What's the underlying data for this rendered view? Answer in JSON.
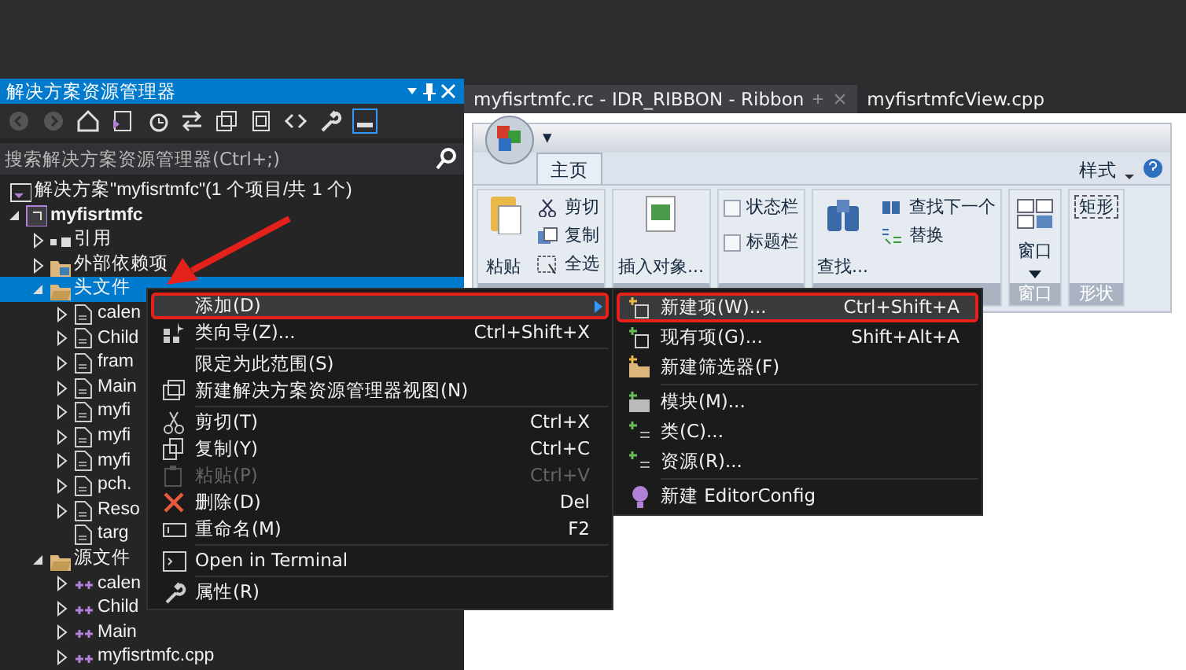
{
  "explorer": {
    "title": "解决方案资源管理器",
    "search": {
      "placeholder": "搜索解决方案资源管理器(Ctrl+;)"
    },
    "tree": [
      {
        "label": "解决方案\"myfisrtmfc\"(1 个项目/共 1 个)",
        "kind": "solution",
        "selected": false,
        "children": [
          {
            "label": "myfisrtmfc",
            "kind": "project",
            "expanded": true,
            "selected": false,
            "children": [
              {
                "label": "引用",
                "kind": "refs",
                "expanded": false,
                "selected": false
              },
              {
                "label": "外部依赖项",
                "kind": "deps",
                "expanded": false,
                "selected": false
              },
              {
                "label": "头文件",
                "kind": "folder",
                "expanded": true,
                "selected": true,
                "children": [
                  {
                    "label": "calen",
                    "kind": "header",
                    "expanded": false,
                    "selected": false
                  },
                  {
                    "label": "Child",
                    "kind": "header",
                    "expanded": false,
                    "selected": false
                  },
                  {
                    "label": "fram",
                    "kind": "header",
                    "expanded": false,
                    "selected": false
                  },
                  {
                    "label": "Main",
                    "kind": "header",
                    "expanded": false,
                    "selected": false
                  },
                  {
                    "label": "myfi",
                    "kind": "header",
                    "expanded": false,
                    "selected": false
                  },
                  {
                    "label": "myfi",
                    "kind": "header",
                    "expanded": false,
                    "selected": false
                  },
                  {
                    "label": "myfi",
                    "kind": "header",
                    "expanded": false,
                    "selected": false
                  },
                  {
                    "label": "pch.",
                    "kind": "header",
                    "expanded": false,
                    "selected": false
                  },
                  {
                    "label": "Reso",
                    "kind": "header",
                    "expanded": false,
                    "selected": false
                  },
                  {
                    "label": "targ",
                    "kind": "header",
                    "selected": false
                  }
                ]
              },
              {
                "label": "源文件",
                "kind": "folder",
                "expanded": true,
                "selected": false,
                "children": [
                  {
                    "label": "calen",
                    "kind": "source",
                    "expanded": false,
                    "selected": false
                  },
                  {
                    "label": "Child",
                    "kind": "source",
                    "expanded": false,
                    "selected": false
                  },
                  {
                    "label": "Main",
                    "kind": "source",
                    "expanded": false,
                    "selected": false
                  },
                  {
                    "label": "myfisrtmfc.cpp",
                    "kind": "source",
                    "expanded": false,
                    "selected": false
                  }
                ]
              }
            ]
          }
        ]
      }
    ]
  },
  "doc_tabs": [
    {
      "label": "myfisrtmfc.rc - IDR_RIBBON - Ribbon",
      "selected": true
    },
    {
      "label": "myfisrtmfcView.cpp",
      "selected": false
    }
  ],
  "ribbon": {
    "quick_access": "▾",
    "tabs": [
      {
        "label": "主页",
        "selected": true
      }
    ],
    "style_label": "样式",
    "groups": [
      {
        "controls": [
          {
            "kind": "large",
            "label": "粘贴"
          },
          {
            "kind": "small",
            "label": "剪切"
          },
          {
            "kind": "small",
            "label": "复制"
          },
          {
            "kind": "small",
            "label": "全选"
          }
        ]
      },
      {
        "controls": [
          {
            "kind": "large",
            "label": "插入对象..."
          }
        ]
      },
      {
        "controls": [
          {
            "kind": "check",
            "label": "状态栏",
            "checked": false
          },
          {
            "kind": "check",
            "label": "标题栏",
            "checked": false
          }
        ]
      },
      {
        "controls": [
          {
            "kind": "large",
            "label": "查找..."
          },
          {
            "kind": "small",
            "label": "查找下一个"
          },
          {
            "kind": "small",
            "label": "替换"
          }
        ]
      },
      {
        "label": "窗口",
        "controls": [
          {
            "kind": "dropdown",
            "label": "窗口"
          }
        ]
      },
      {
        "label": "形状",
        "controls": [
          {
            "kind": "shape",
            "label": "矩形"
          }
        ]
      }
    ]
  },
  "context_menu": [
    {
      "kind": "item",
      "label": "添加(D)",
      "submenu": true,
      "highlighted": true,
      "disabled": false
    },
    {
      "kind": "item",
      "label": "类向导(Z)...",
      "shortcut": "Ctrl+Shift+X",
      "highlighted": false,
      "disabled": false
    },
    {
      "kind": "separator"
    },
    {
      "kind": "item",
      "label": "限定为此范围(S)",
      "highlighted": false,
      "disabled": false
    },
    {
      "kind": "item",
      "label": "新建解决方案资源管理器视图(N)",
      "highlighted": false,
      "disabled": false
    },
    {
      "kind": "separator"
    },
    {
      "kind": "item",
      "label": "剪切(T)",
      "shortcut": "Ctrl+X",
      "highlighted": false,
      "disabled": false
    },
    {
      "kind": "item",
      "label": "复制(Y)",
      "shortcut": "Ctrl+C",
      "highlighted": false,
      "disabled": false
    },
    {
      "kind": "item",
      "label": "粘贴(P)",
      "shortcut": "Ctrl+V",
      "highlighted": false,
      "disabled": true
    },
    {
      "kind": "item",
      "label": "删除(D)",
      "shortcut": "Del",
      "highlighted": false,
      "disabled": false
    },
    {
      "kind": "item",
      "label": "重命名(M)",
      "shortcut": "F2",
      "highlighted": false,
      "disabled": false
    },
    {
      "kind": "separator"
    },
    {
      "kind": "item",
      "label": "Open in Terminal",
      "highlighted": false,
      "disabled": false
    },
    {
      "kind": "separator"
    },
    {
      "kind": "item",
      "label": "属性(R)",
      "highlighted": false,
      "disabled": false
    }
  ],
  "submenu": [
    {
      "kind": "item",
      "label": "新建项(W)...",
      "shortcut": "Ctrl+Shift+A",
      "highlighted": true
    },
    {
      "kind": "item",
      "label": "现有项(G)...",
      "shortcut": "Shift+Alt+A",
      "highlighted": false
    },
    {
      "kind": "item",
      "label": "新建筛选器(F)",
      "highlighted": false
    },
    {
      "kind": "separator"
    },
    {
      "kind": "item",
      "label": "模块(M)...",
      "highlighted": false
    },
    {
      "kind": "item",
      "label": "类(C)...",
      "highlighted": false
    },
    {
      "kind": "item",
      "label": "资源(R)...",
      "highlighted": false
    },
    {
      "kind": "separator"
    },
    {
      "kind": "item",
      "label": "新建 EditorConfig",
      "highlighted": false
    }
  ]
}
